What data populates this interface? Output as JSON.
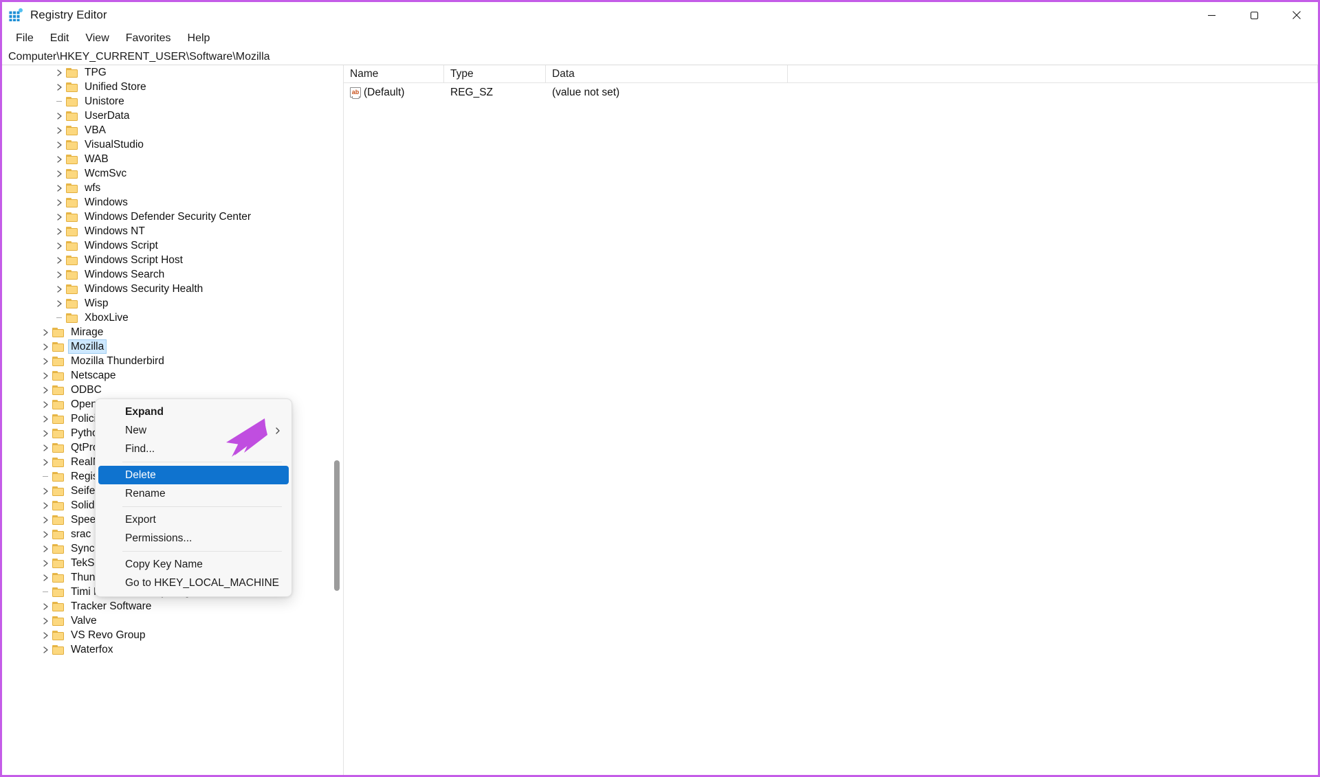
{
  "window": {
    "title": "Registry Editor",
    "icon": "registry-editor-icon",
    "controls": [
      {
        "name": "minimize",
        "glyph": "minimize-icon"
      },
      {
        "name": "maximize",
        "glyph": "maximize-icon"
      },
      {
        "name": "close",
        "glyph": "close-icon"
      }
    ]
  },
  "menubar": {
    "items": [
      {
        "label": "File"
      },
      {
        "label": "Edit"
      },
      {
        "label": "View"
      },
      {
        "label": "Favorites"
      },
      {
        "label": "Help"
      }
    ]
  },
  "address": {
    "path": "Computer\\HKEY_CURRENT_USER\\Software\\Mozilla"
  },
  "tree": {
    "rows": [
      {
        "label": "TPG",
        "indent": 2,
        "expander": "chevron",
        "selected": false
      },
      {
        "label": "Unified Store",
        "indent": 2,
        "expander": "chevron",
        "selected": false
      },
      {
        "label": "Unistore",
        "indent": 2,
        "expander": "dash",
        "selected": false
      },
      {
        "label": "UserData",
        "indent": 2,
        "expander": "chevron",
        "selected": false
      },
      {
        "label": "VBA",
        "indent": 2,
        "expander": "chevron",
        "selected": false
      },
      {
        "label": "VisualStudio",
        "indent": 2,
        "expander": "chevron",
        "selected": false
      },
      {
        "label": "WAB",
        "indent": 2,
        "expander": "chevron",
        "selected": false
      },
      {
        "label": "WcmSvc",
        "indent": 2,
        "expander": "chevron",
        "selected": false
      },
      {
        "label": "wfs",
        "indent": 2,
        "expander": "chevron",
        "selected": false
      },
      {
        "label": "Windows",
        "indent": 2,
        "expander": "chevron",
        "selected": false
      },
      {
        "label": "Windows Defender Security Center",
        "indent": 2,
        "expander": "chevron",
        "selected": false
      },
      {
        "label": "Windows NT",
        "indent": 2,
        "expander": "chevron",
        "selected": false
      },
      {
        "label": "Windows Script",
        "indent": 2,
        "expander": "chevron",
        "selected": false
      },
      {
        "label": "Windows Script Host",
        "indent": 2,
        "expander": "chevron",
        "selected": false
      },
      {
        "label": "Windows Search",
        "indent": 2,
        "expander": "chevron",
        "selected": false
      },
      {
        "label": "Windows Security Health",
        "indent": 2,
        "expander": "chevron",
        "selected": false
      },
      {
        "label": "Wisp",
        "indent": 2,
        "expander": "chevron",
        "selected": false
      },
      {
        "label": "XboxLive",
        "indent": 2,
        "expander": "dash",
        "selected": false
      },
      {
        "label": "Mirage",
        "indent": 1,
        "expander": "chevron",
        "selected": false
      },
      {
        "label": "Mozilla",
        "indent": 1,
        "expander": "chevron",
        "selected": true
      },
      {
        "label": "Mozilla Thunderbird",
        "indent": 1,
        "expander": "chevron",
        "selected": false
      },
      {
        "label": "Netscape",
        "indent": 1,
        "expander": "chevron",
        "selected": false
      },
      {
        "label": "ODBC",
        "indent": 1,
        "expander": "chevron",
        "selected": false
      },
      {
        "label": "OpenOffice",
        "indent": 1,
        "expander": "chevron",
        "selected": false
      },
      {
        "label": "Policies",
        "indent": 1,
        "expander": "chevron",
        "selected": false
      },
      {
        "label": "Python",
        "indent": 1,
        "expander": "chevron",
        "selected": false
      },
      {
        "label": "QtProject",
        "indent": 1,
        "expander": "chevron",
        "selected": false
      },
      {
        "label": "RealNetworks",
        "indent": 1,
        "expander": "chevron",
        "selected": false
      },
      {
        "label": "RegisteredApplications",
        "indent": 1,
        "expander": "dash",
        "selected": false
      },
      {
        "label": "Seifert",
        "indent": 1,
        "expander": "chevron",
        "selected": false
      },
      {
        "label": "SolidDocuments",
        "indent": 1,
        "expander": "chevron",
        "selected": false
      },
      {
        "label": "SpeedCrunch",
        "indent": 1,
        "expander": "chevron",
        "selected": false
      },
      {
        "label": "srac",
        "indent": 1,
        "expander": "chevron",
        "selected": false
      },
      {
        "label": "SyncEngines",
        "indent": 1,
        "expander": "chevron",
        "selected": false
      },
      {
        "label": "TekSoft",
        "indent": 1,
        "expander": "chevron",
        "selected": false
      },
      {
        "label": "Thunderbird",
        "indent": 1,
        "expander": "chevron",
        "selected": false
      },
      {
        "label": "Timi Personal Computing",
        "indent": 1,
        "expander": "dash",
        "selected": false
      },
      {
        "label": "Tracker Software",
        "indent": 1,
        "expander": "chevron",
        "selected": false
      },
      {
        "label": "Valve",
        "indent": 1,
        "expander": "chevron",
        "selected": false
      },
      {
        "label": "VS Revo Group",
        "indent": 1,
        "expander": "chevron",
        "selected": false
      },
      {
        "label": "Waterfox",
        "indent": 1,
        "expander": "chevron",
        "selected": false
      }
    ]
  },
  "values": {
    "columns": [
      {
        "label": "Name"
      },
      {
        "label": "Type"
      },
      {
        "label": "Data"
      }
    ],
    "rows": [
      {
        "icon": "string-value-icon",
        "name": "(Default)",
        "type": "REG_SZ",
        "data": "(value not set)"
      }
    ]
  },
  "context_menu": {
    "items": [
      {
        "label": "Expand",
        "style": "bold",
        "submenu": false,
        "highlight": false,
        "separator_after": false
      },
      {
        "label": "New",
        "style": "normal",
        "submenu": true,
        "highlight": false,
        "separator_after": false
      },
      {
        "label": "Find...",
        "style": "normal",
        "submenu": false,
        "highlight": false,
        "separator_after": true
      },
      {
        "label": "Delete",
        "style": "normal",
        "submenu": false,
        "highlight": true,
        "separator_after": false
      },
      {
        "label": "Rename",
        "style": "normal",
        "submenu": false,
        "highlight": false,
        "separator_after": true
      },
      {
        "label": "Export",
        "style": "normal",
        "submenu": false,
        "highlight": false,
        "separator_after": false
      },
      {
        "label": "Permissions...",
        "style": "normal",
        "submenu": false,
        "highlight": false,
        "separator_after": true
      },
      {
        "label": "Copy Key Name",
        "style": "normal",
        "submenu": false,
        "highlight": false,
        "separator_after": false
      },
      {
        "label": "Go to HKEY_LOCAL_MACHINE",
        "style": "normal",
        "submenu": false,
        "highlight": false,
        "separator_after": false
      }
    ]
  },
  "colors": {
    "highlight": "#0f73cf",
    "selection": "#cde8ff",
    "annotation_arrow": "#c04ee0",
    "frame_border": "#c45ce8",
    "folder": "#fcd87f"
  },
  "annotation": {
    "arrow": "pointer-arrow-to-delete"
  }
}
